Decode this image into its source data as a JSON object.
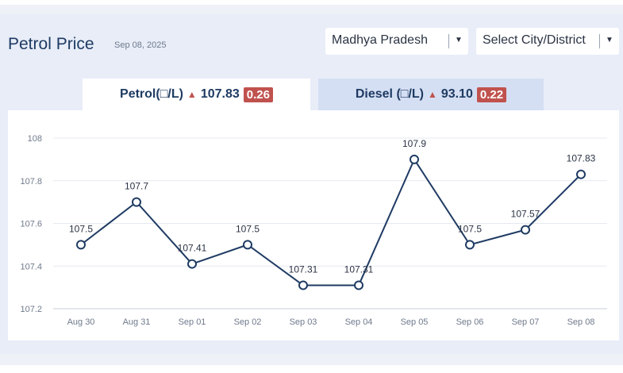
{
  "header": {
    "title": "Petrol Price",
    "date": "Sep 08, 2025",
    "state_select": "Madhya Pradesh",
    "city_select": "Select City/District"
  },
  "tabs": {
    "petrol": {
      "label": "Petrol(□/L)",
      "price": "107.83",
      "change": "0.26"
    },
    "diesel": {
      "label": "Diesel (□/L)",
      "price": "93.10",
      "change": "0.22"
    }
  },
  "colors": {
    "line": "#1f3b63",
    "up_badge": "#c0524e",
    "title": "#1f3b63"
  },
  "chart_data": {
    "type": "line",
    "categories": [
      "Aug 30",
      "Aug 31",
      "Sep 01",
      "Sep 02",
      "Sep 03",
      "Sep 04",
      "Sep 05",
      "Sep 06",
      "Sep 07",
      "Sep 08"
    ],
    "series": [
      {
        "values": [
          107.5,
          107.7,
          107.41,
          107.5,
          107.31,
          107.31,
          107.9,
          107.5,
          107.57,
          107.83
        ]
      }
    ],
    "data_labels": [
      "107.5",
      "107.7",
      "107.41",
      "107.5",
      "107.31",
      "107.31",
      "107.9",
      "107.5",
      "107.57",
      "107.83"
    ],
    "ylim": [
      107.2,
      108
    ],
    "yticks": [
      "107.2",
      "107.4",
      "107.6",
      "107.8",
      "108"
    ],
    "grid": true
  }
}
